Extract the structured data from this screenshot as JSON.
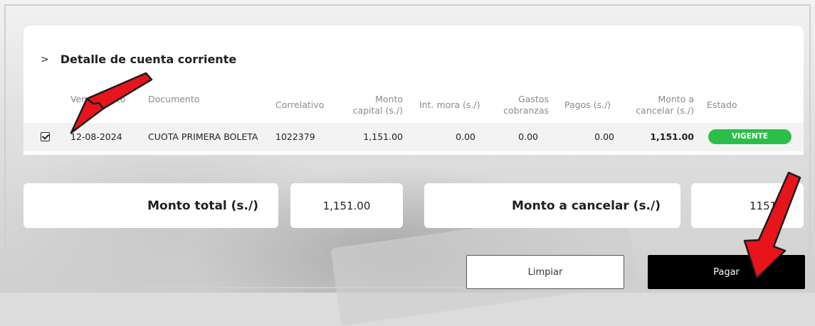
{
  "section": {
    "title": "Detalle de cuenta corriente"
  },
  "table": {
    "headers": {
      "vencimiento": "Vencimiento",
      "documento": "Documento",
      "correlativo": "Correlativo",
      "monto_capital": [
        "Monto",
        "capital (s./)"
      ],
      "int_mora": "Int. mora (s./)",
      "gastos": [
        "Gastos",
        "cobranzas"
      ],
      "pagos": "Pagos (s./)",
      "monto_cancelar": [
        "Monto a",
        "cancelar (s./)"
      ],
      "estado": "Estado"
    },
    "rows": [
      {
        "checked": true,
        "vencimiento": "12-08-2024",
        "documento": "CUOTA PRIMERA BOLETA",
        "correlativo": "1022379",
        "monto_capital": "1,151.00",
        "int_mora": "0.00",
        "gastos": "0.00",
        "pagos": "0.00",
        "monto_cancelar": "1,151.00",
        "estado": "VIGENTE"
      }
    ]
  },
  "summary": {
    "total_label": "Monto total (s./)",
    "total_value": "1,151.00",
    "cancel_label": "Monto a cancelar (s./)",
    "cancel_value": "1151.0"
  },
  "buttons": {
    "clear": "Limpiar",
    "pay": "Pagar"
  },
  "colors": {
    "status": "#2bbf4a",
    "annotation_arrow": "#e8141b",
    "pay_button": "#000000"
  }
}
